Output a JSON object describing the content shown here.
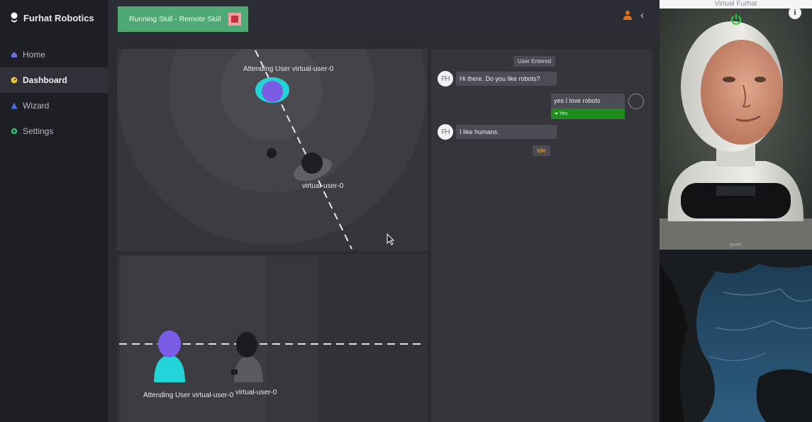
{
  "brand": {
    "name": "Furhat Robotics"
  },
  "nav": {
    "items": [
      {
        "label": "Home",
        "icon": "home-icon"
      },
      {
        "label": "Dashboard",
        "icon": "dashboard-icon"
      },
      {
        "label": "Wizard",
        "icon": "wizard-icon"
      },
      {
        "label": "Settings",
        "icon": "gear-icon"
      }
    ],
    "active": "Dashboard"
  },
  "topbar": {
    "skill_label": "Running Skill - Remote Skill"
  },
  "map": {
    "attending_label": "Attending User virtual-user-0",
    "user_label": "virtual-user-0"
  },
  "camera": {
    "attending_label": "Attending User virtual-user-0",
    "user_label": "virtual-user-0"
  },
  "chat": {
    "event_user_entered": "User Entered",
    "avatar_initials": "FH",
    "messages": [
      {
        "from": "robot",
        "text": "Hi there. Do you like robots?"
      },
      {
        "from": "user",
        "text": "yes I love robots",
        "intent": "➜ Yes"
      },
      {
        "from": "robot",
        "text": "I like humans."
      }
    ],
    "status": "Idle"
  },
  "virtual_furhat": {
    "title": "Virtual Furhat",
    "info": "i",
    "fps": "30 FPS"
  },
  "colors": {
    "sidebar_bg": "#1e1f25",
    "skill_green": "#4fa974",
    "intent_green": "#1f8a1e",
    "attending_purple": "#7b5ce6",
    "attending_cyan": "#22d3d8",
    "power_green": "#2ecc40"
  }
}
